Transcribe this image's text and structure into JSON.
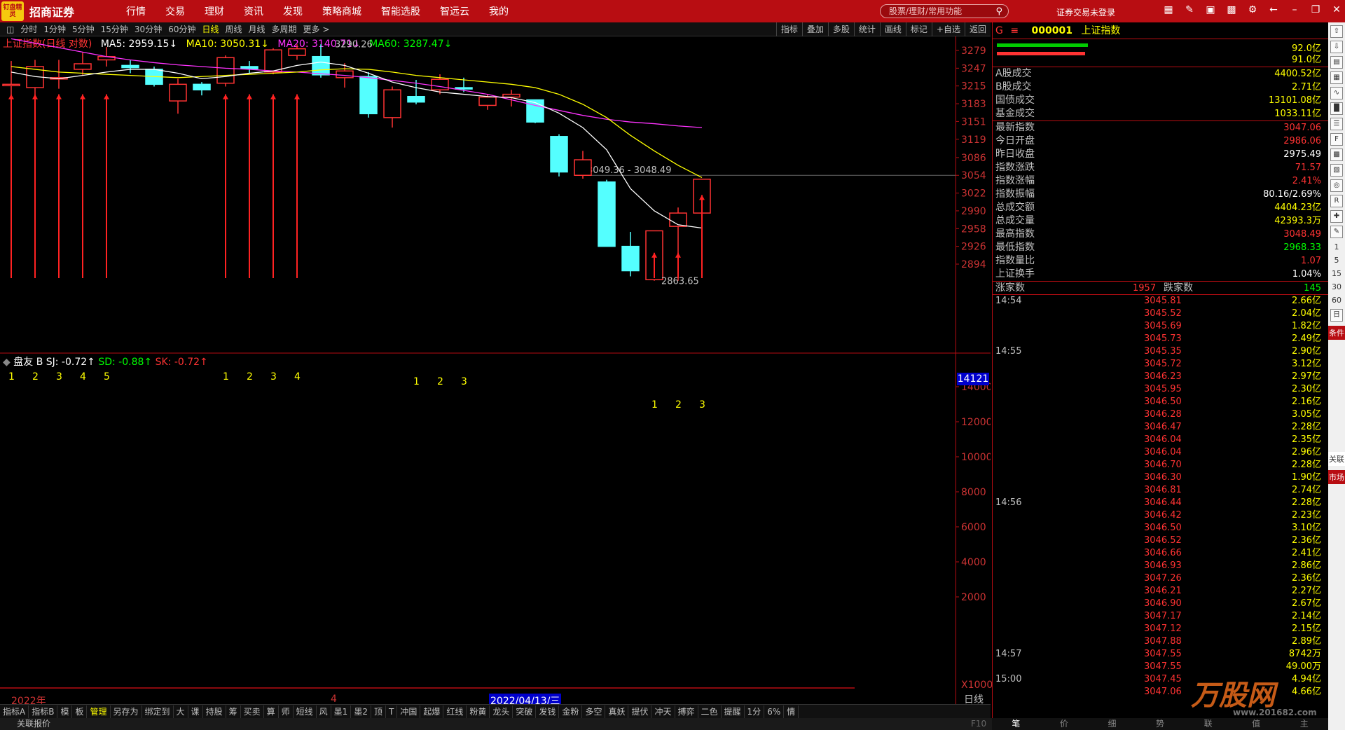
{
  "app": {
    "logo_text": "钉盘精灵",
    "brand": "招商证券"
  },
  "menu": [
    "行情",
    "交易",
    "理财",
    "资讯",
    "发现",
    "策略商城",
    "智能选股",
    "智远云",
    "我的"
  ],
  "search": {
    "placeholder": "股票/理财/常用功能"
  },
  "login_status": "证券交易未登录",
  "periods": [
    "分时",
    "1分钟",
    "5分钟",
    "15分钟",
    "30分钟",
    "60分钟",
    "日线",
    "周线",
    "月线",
    "多周期",
    "更多 >"
  ],
  "active_period": "日线",
  "chart_tools": [
    "指标",
    "叠加",
    "多股",
    "统计",
    "画线",
    "标记",
    "+自选",
    "返回"
  ],
  "legend": {
    "title": "上证指数(日线 对数)",
    "ma5": "MA5: 2959.15↓",
    "ma10": "MA10: 3050.31↓",
    "ma20": "MA20: 3140.71↓",
    "ma60": "MA60: 3287.47↓"
  },
  "annotations": {
    "high": "3290.26",
    "low": "2863.65",
    "range": "3049.36 - 3048.49",
    "date_cursor": "2022/04/13/三",
    "year": "2022年",
    "month": "4"
  },
  "osc_legend": {
    "name": "盘友",
    "b": "B",
    "sj": "SJ: -0.72↑",
    "sd": "SD: -0.88↑",
    "sk": "SK: -0.72↑"
  },
  "osc_value": "14121",
  "osc_axis_unit": "X1000",
  "period_label": "日线",
  "tabs": [
    "指标A",
    "指标B",
    "模",
    "板",
    "管理",
    "另存为",
    "绑定到",
    "大",
    "课",
    "持股",
    "筹",
    "买卖",
    "算",
    "师",
    "短线",
    "风",
    "墨1",
    "墨2",
    "顶",
    "T",
    "冲国",
    "起爆",
    "红线",
    "粉黄",
    "龙头",
    "突破",
    "发钱",
    "金粉",
    "多空",
    "真妖",
    "提伏",
    "冲天",
    "搏弈",
    "二色",
    "提醒",
    "1分",
    "6%",
    "情"
  ],
  "active_tab": "管理",
  "statusbar": {
    "left": "关联报价",
    "right": "F10"
  },
  "quote": {
    "code": "000001",
    "name": "上证指数",
    "top_values": [
      "92.0亿",
      "91.0亿"
    ],
    "turnover": [
      {
        "k": "A股成交",
        "v": "4400.52亿"
      },
      {
        "k": "B股成交",
        "v": "2.71亿"
      },
      {
        "k": "国债成交",
        "v": "13101.08亿"
      },
      {
        "k": "基金成交",
        "v": "1033.11亿"
      }
    ],
    "stats": [
      {
        "k": "最新指数",
        "v": "3047.06",
        "c": "#ff3333"
      },
      {
        "k": "今日开盘",
        "v": "2986.06",
        "c": "#ff3333"
      },
      {
        "k": "昨日收盘",
        "v": "2975.49",
        "c": "#ffffff"
      },
      {
        "k": "指数涨跌",
        "v": "71.57",
        "c": "#ff3333"
      },
      {
        "k": "指数涨幅",
        "v": "2.41%",
        "c": "#ff3333"
      },
      {
        "k": "指数振幅",
        "v": "80.16/2.69%",
        "c": "#ffffff"
      },
      {
        "k": "总成交额",
        "v": "4404.23亿",
        "c": "#ffff00"
      },
      {
        "k": "总成交量",
        "v": "42393.3万",
        "c": "#ffff00"
      },
      {
        "k": "最高指数",
        "v": "3048.49",
        "c": "#ff3333"
      },
      {
        "k": "最低指数",
        "v": "2968.33",
        "c": "#00ff00"
      },
      {
        "k": "指数量比",
        "v": "1.07",
        "c": "#ff3333"
      },
      {
        "k": "上证换手",
        "v": "1.04%",
        "c": "#ffffff"
      }
    ],
    "adv_label": "涨家数",
    "adv": "1957",
    "dec_label": "跌家数",
    "dec": "145"
  },
  "ticks": [
    {
      "t": "14:54",
      "p": "3045.81",
      "v": "2.66亿"
    },
    {
      "t": "",
      "p": "3045.52",
      "v": "2.04亿"
    },
    {
      "t": "",
      "p": "3045.69",
      "v": "1.82亿"
    },
    {
      "t": "",
      "p": "3045.73",
      "v": "2.49亿"
    },
    {
      "t": "14:55",
      "p": "3045.35",
      "v": "2.90亿"
    },
    {
      "t": "",
      "p": "3045.72",
      "v": "3.12亿"
    },
    {
      "t": "",
      "p": "3046.23",
      "v": "2.97亿"
    },
    {
      "t": "",
      "p": "3045.95",
      "v": "2.30亿"
    },
    {
      "t": "",
      "p": "3046.50",
      "v": "2.16亿"
    },
    {
      "t": "",
      "p": "3046.28",
      "v": "3.05亿"
    },
    {
      "t": "",
      "p": "3046.47",
      "v": "2.28亿"
    },
    {
      "t": "",
      "p": "3046.04",
      "v": "2.35亿"
    },
    {
      "t": "",
      "p": "3046.04",
      "v": "2.96亿"
    },
    {
      "t": "",
      "p": "3046.70",
      "v": "2.28亿"
    },
    {
      "t": "",
      "p": "3046.30",
      "v": "1.90亿"
    },
    {
      "t": "",
      "p": "3046.81",
      "v": "2.74亿"
    },
    {
      "t": "14:56",
      "p": "3046.44",
      "v": "2.28亿"
    },
    {
      "t": "",
      "p": "3046.42",
      "v": "2.23亿"
    },
    {
      "t": "",
      "p": "3046.50",
      "v": "3.10亿"
    },
    {
      "t": "",
      "p": "3046.52",
      "v": "2.36亿"
    },
    {
      "t": "",
      "p": "3046.66",
      "v": "2.41亿"
    },
    {
      "t": "",
      "p": "3046.93",
      "v": "2.86亿"
    },
    {
      "t": "",
      "p": "3047.26",
      "v": "2.36亿"
    },
    {
      "t": "",
      "p": "3046.21",
      "v": "2.27亿"
    },
    {
      "t": "",
      "p": "3046.90",
      "v": "2.67亿"
    },
    {
      "t": "",
      "p": "3047.17",
      "v": "2.14亿"
    },
    {
      "t": "",
      "p": "3047.12",
      "v": "2.15亿"
    },
    {
      "t": "",
      "p": "3047.88",
      "v": "2.89亿"
    },
    {
      "t": "14:57",
      "p": "3047.55",
      "v": "8742万"
    },
    {
      "t": "",
      "p": "3047.55",
      "v": "49.00万"
    },
    {
      "t": "15:00",
      "p": "3047.45",
      "v": "4.94亿"
    },
    {
      "t": "",
      "p": "3047.06",
      "v": "4.66亿"
    }
  ],
  "right_tabs": [
    "笔",
    "价",
    "细",
    "势",
    "联",
    "值",
    "主"
  ],
  "icon_column": {
    "numbers": [
      "1",
      "5",
      "15",
      "30",
      "60"
    ],
    "day": "日",
    "condition": "条件",
    "relation": "关联",
    "market": "市场"
  },
  "watermark": {
    "text": "万股网",
    "url": "www.201682.com"
  },
  "chart_data": {
    "type": "candlestick",
    "price_ticks": [
      "3279",
      "3247",
      "3215",
      "3183",
      "3151",
      "3119",
      "3086",
      "3054",
      "3022",
      "2990",
      "2958",
      "2926",
      "2894"
    ],
    "osc_ticks": [
      "14000",
      "12000",
      "10000",
      "8000",
      "6000",
      "4000",
      "2000"
    ],
    "candles": [
      {
        "o": 3218,
        "c": 3218,
        "h": 3260,
        "l": 3200
      },
      {
        "o": 3212,
        "c": 3250,
        "h": 3262,
        "l": 3200
      },
      {
        "o": 3230,
        "c": 3230,
        "h": 3262,
        "l": 3210
      },
      {
        "o": 3245,
        "c": 3255,
        "h": 3275,
        "l": 3235
      },
      {
        "o": 3262,
        "c": 3268,
        "h": 3285,
        "l": 3250
      },
      {
        "o": 3252,
        "c": 3248,
        "h": 3262,
        "l": 3238
      },
      {
        "o": 3245,
        "c": 3218,
        "h": 3250,
        "l": 3214
      },
      {
        "o": 3188,
        "c": 3218,
        "h": 3228,
        "l": 3165
      },
      {
        "o": 3218,
        "c": 3208,
        "h": 3222,
        "l": 3198
      },
      {
        "o": 3220,
        "c": 3266,
        "h": 3270,
        "l": 3214
      },
      {
        "o": 3250,
        "c": 3246,
        "h": 3260,
        "l": 3238
      },
      {
        "o": 3240,
        "c": 3280,
        "h": 3283,
        "l": 3236
      },
      {
        "o": 3270,
        "c": 3282,
        "h": 3290,
        "l": 3262
      },
      {
        "o": 3268,
        "c": 3235,
        "h": 3290,
        "l": 3230
      },
      {
        "o": 3230,
        "c": 3242,
        "h": 3256,
        "l": 3212
      },
      {
        "o": 3232,
        "c": 3165,
        "h": 3240,
        "l": 3158
      },
      {
        "o": 3158,
        "c": 3208,
        "h": 3214,
        "l": 3140
      },
      {
        "o": 3196,
        "c": 3186,
        "h": 3226,
        "l": 3182
      },
      {
        "o": 3208,
        "c": 3227,
        "h": 3236,
        "l": 3200
      },
      {
        "o": 3212,
        "c": 3210,
        "h": 3230,
        "l": 3204
      },
      {
        "o": 3180,
        "c": 3195,
        "h": 3200,
        "l": 3172
      },
      {
        "o": 3195,
        "c": 3200,
        "h": 3208,
        "l": 3178
      },
      {
        "o": 3190,
        "c": 3150,
        "h": 3190,
        "l": 3148
      },
      {
        "o": 3124,
        "c": 3060,
        "h": 3128,
        "l": 3052
      },
      {
        "o": 3054,
        "c": 3082,
        "h": 3098,
        "l": 3048
      },
      {
        "o": 3042,
        "c": 2926,
        "h": 3046,
        "l": 2926
      },
      {
        "o": 2926,
        "c": 2882,
        "h": 2952,
        "l": 2872
      },
      {
        "o": 2866,
        "c": 2954,
        "h": 2954,
        "l": 2864
      },
      {
        "o": 2962,
        "c": 2986,
        "h": 2996,
        "l": 2864
      },
      {
        "o": 2986,
        "c": 3047,
        "h": 3048,
        "l": 2968
      }
    ],
    "ma5": [
      3240,
      3232,
      3228,
      3234,
      3240,
      3245,
      3245,
      3238,
      3228,
      3232,
      3238,
      3242,
      3252,
      3258,
      3252,
      3238,
      3222,
      3212,
      3204,
      3200,
      3196,
      3194,
      3185,
      3166,
      3140,
      3100,
      3030,
      2990,
      2965,
      2959
    ],
    "ma10": [
      3250,
      3245,
      3240,
      3238,
      3236,
      3234,
      3232,
      3230,
      3232,
      3234,
      3236,
      3238,
      3240,
      3244,
      3246,
      3245,
      3240,
      3234,
      3230,
      3226,
      3222,
      3218,
      3212,
      3200,
      3182,
      3158,
      3126,
      3098,
      3072,
      3050
    ],
    "ma20": [
      3300,
      3292,
      3284,
      3276,
      3268,
      3262,
      3257,
      3253,
      3250,
      3247,
      3245,
      3242,
      3240,
      3237,
      3234,
      3230,
      3225,
      3220,
      3214,
      3207,
      3200,
      3190,
      3180,
      3171,
      3162,
      3155,
      3150,
      3147,
      3143,
      3140
    ],
    "signal_groups": [
      {
        "labels": [
          "1",
          "2",
          "3",
          "4",
          "5"
        ],
        "start": 0
      },
      {
        "labels": [
          "1",
          "2",
          "3",
          "4"
        ],
        "start": 9
      },
      {
        "labels": [
          "1",
          "2",
          "3"
        ],
        "start": 17
      },
      {
        "labels": [
          "1",
          "2",
          "3"
        ],
        "start": 27
      }
    ]
  }
}
